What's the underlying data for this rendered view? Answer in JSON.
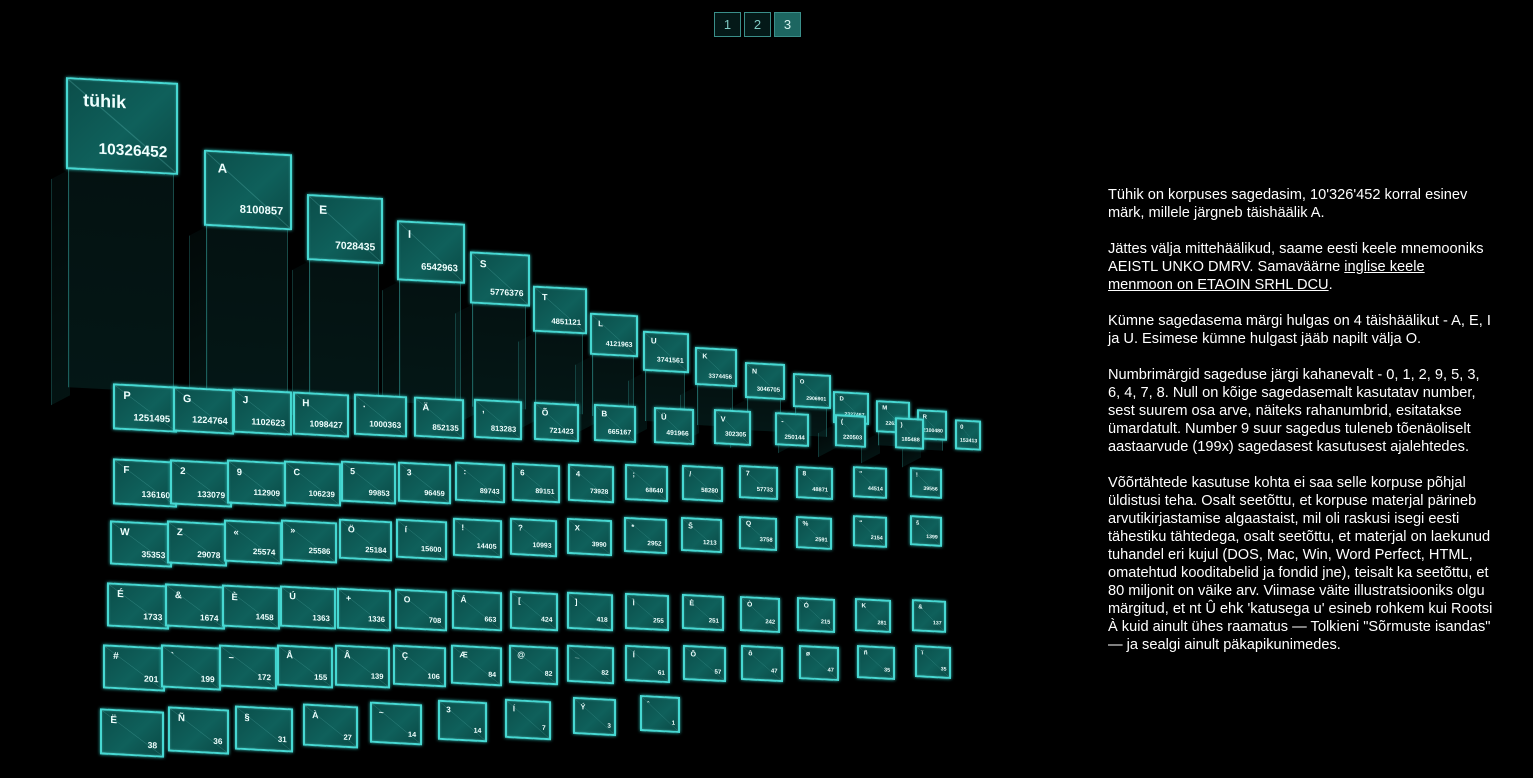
{
  "pager": {
    "pages": [
      "1",
      "2",
      "3"
    ],
    "active_index": 2
  },
  "accent_colors": {
    "card_edge": "#47d8d2",
    "card_fill": "#0f605b",
    "background": "#000000"
  },
  "chart_data": {
    "type": "bar",
    "categories": [
      "tühik",
      "A",
      "E",
      "I",
      "S",
      "T",
      "L",
      "U",
      "K",
      "N",
      "O",
      "D",
      "M",
      "R",
      "P",
      "G",
      "J",
      "H",
      ".",
      "Ä",
      "'",
      "Õ",
      "B",
      "Ü",
      "V",
      "-",
      "(",
      ")",
      "0",
      ",",
      "F",
      "2",
      "9",
      "C",
      "5",
      "1",
      "3",
      "6",
      "4",
      ":",
      "/",
      "7",
      "8",
      "\"",
      "ž",
      "W",
      "Z",
      "«",
      "»",
      "Ö",
      "í",
      "!",
      "?",
      "X",
      "*",
      "Š",
      "Q",
      "%",
      "“",
      "š",
      "É",
      "&",
      "È",
      "Ú",
      "+",
      "O",
      "Á",
      "[",
      "]",
      "Ì",
      "È",
      "Ò",
      "Ó",
      "K",
      "&",
      "#",
      "`",
      "–",
      "Å",
      "Â",
      "Ç",
      "Æ",
      "@",
      "_",
      "Í",
      "Ô",
      "ô",
      "ø",
      "ñ",
      "ï",
      "È",
      "Ñ",
      "§",
      "À",
      "~",
      "3",
      "Í",
      "Ý",
      "ˆ"
    ],
    "values": [
      10326452,
      8100857,
      7028435,
      6542963,
      5776376,
      4851121,
      4121963,
      3741561,
      3374456,
      3046705,
      2906901,
      2327467,
      2262552,
      2100480,
      1251495,
      1224764,
      1102623,
      1098427,
      1000363,
      852135,
      813283,
      721423,
      665167,
      491966,
      302305,
      250144,
      220503,
      185488,
      153413,
      136160,
      133079,
      112909,
      106239,
      99853,
      96459,
      89743,
      89151,
      73928,
      68640,
      58280,
      57733,
      48871,
      44514,
      35353,
      29078,
      25574,
      25586,
      25184,
      15600,
      14405,
      10993,
      3990,
      2952,
      1213,
      3758,
      2591,
      2154,
      1399,
      1733,
      1674,
      1458,
      1363,
      1336,
      708,
      663,
      424,
      418,
      255,
      251,
      242,
      215,
      281,
      137,
      201,
      199,
      172,
      155,
      139,
      106,
      84,
      82,
      82,
      61,
      57,
      47,
      47,
      35,
      35,
      38,
      36,
      31,
      27,
      14,
      14,
      7,
      3,
      1
    ],
    "title": "",
    "xlabel": "",
    "ylabel": ""
  },
  "rows": [
    [
      {
        "char": "tühik",
        "count": "10326452"
      },
      {
        "char": "A",
        "count": "8100857"
      },
      {
        "char": "E",
        "count": "7028435"
      },
      {
        "char": "I",
        "count": "6542963"
      },
      {
        "char": "S",
        "count": "5776376"
      },
      {
        "char": "T",
        "count": "4851121"
      },
      {
        "char": "L",
        "count": "4121963"
      },
      {
        "char": "U",
        "count": "3741561"
      },
      {
        "char": "K",
        "count": "3374456"
      },
      {
        "char": "N",
        "count": "3046705"
      },
      {
        "char": "O",
        "count": "2906901"
      },
      {
        "char": "D",
        "count": "2327467"
      },
      {
        "char": "M",
        "count": "2262552"
      },
      {
        "char": "R",
        "count": "2100480"
      }
    ],
    [
      {
        "char": "P",
        "count": "1251495"
      },
      {
        "char": "G",
        "count": "1224764"
      },
      {
        "char": "J",
        "count": "1102623"
      },
      {
        "char": "H",
        "count": "1098427"
      },
      {
        "char": ".",
        "count": "1000363"
      },
      {
        "char": "Ä",
        "count": "852135"
      },
      {
        "char": ",",
        "count": "813283"
      },
      {
        "char": "Õ",
        "count": "721423"
      },
      {
        "char": "B",
        "count": "665167"
      },
      {
        "char": "Ü",
        "count": "491966"
      },
      {
        "char": "V",
        "count": "302305"
      },
      {
        "char": "-",
        "count": "250144"
      },
      {
        "char": "(",
        "count": "220503"
      },
      {
        "char": ")",
        "count": "185488"
      },
      {
        "char": "0",
        "count": "153413"
      }
    ],
    [
      {
        "char": "F",
        "count": "136160"
      },
      {
        "char": "2",
        "count": "133079"
      },
      {
        "char": "9",
        "count": "112909"
      },
      {
        "char": "C",
        "count": "106239"
      },
      {
        "char": "5",
        "count": "99853"
      },
      {
        "char": "3",
        "count": "96459"
      },
      {
        "char": ":",
        "count": "89743"
      },
      {
        "char": "6",
        "count": "89151"
      },
      {
        "char": "4",
        "count": "73928"
      },
      {
        "char": ";",
        "count": "68640"
      },
      {
        "char": "/",
        "count": "58280"
      },
      {
        "char": "7",
        "count": "57733"
      },
      {
        "char": "8",
        "count": "48871"
      },
      {
        "char": "\"",
        "count": "44514"
      },
      {
        "char": "!",
        "count": "39556"
      }
    ],
    [
      {
        "char": "W",
        "count": "35353"
      },
      {
        "char": "Z",
        "count": "29078"
      },
      {
        "char": "«",
        "count": "25574"
      },
      {
        "char": "»",
        "count": "25586"
      },
      {
        "char": "Ö",
        "count": "25184"
      },
      {
        "char": "í",
        "count": "15600"
      },
      {
        "char": "!",
        "count": "14405"
      },
      {
        "char": "?",
        "count": "10993"
      },
      {
        "char": "X",
        "count": "3990"
      },
      {
        "char": "*",
        "count": "2952"
      },
      {
        "char": "Š",
        "count": "1213"
      },
      {
        "char": "Q",
        "count": "3758"
      },
      {
        "char": "%",
        "count": "2591"
      },
      {
        "char": "“",
        "count": "2154"
      },
      {
        "char": "š",
        "count": "1399"
      }
    ],
    [
      {
        "char": "É",
        "count": "1733"
      },
      {
        "char": "&",
        "count": "1674"
      },
      {
        "char": "È",
        "count": "1458"
      },
      {
        "char": "Ú",
        "count": "1363"
      },
      {
        "char": "+",
        "count": "1336"
      },
      {
        "char": "O",
        "count": "708"
      },
      {
        "char": "Á",
        "count": "663"
      },
      {
        "char": "[",
        "count": "424"
      },
      {
        "char": "]",
        "count": "418"
      },
      {
        "char": "Ì",
        "count": "255"
      },
      {
        "char": "È",
        "count": "251"
      },
      {
        "char": "Ò",
        "count": "242"
      },
      {
        "char": "Ó",
        "count": "215"
      },
      {
        "char": "K",
        "count": "281"
      },
      {
        "char": "&",
        "count": "137"
      }
    ],
    [
      {
        "char": "#",
        "count": "201"
      },
      {
        "char": "`",
        "count": "199"
      },
      {
        "char": "–",
        "count": "172"
      },
      {
        "char": "Å",
        "count": "155"
      },
      {
        "char": "Â",
        "count": "139"
      },
      {
        "char": "Ç",
        "count": "106"
      },
      {
        "char": "Æ",
        "count": "84"
      },
      {
        "char": "@",
        "count": "82"
      },
      {
        "char": "_",
        "count": "82"
      },
      {
        "char": "Í",
        "count": "61"
      },
      {
        "char": "Ô",
        "count": "57"
      },
      {
        "char": "ô",
        "count": "47"
      },
      {
        "char": "ø",
        "count": "47"
      },
      {
        "char": "ñ",
        "count": "35"
      },
      {
        "char": "ï",
        "count": "35"
      }
    ],
    [
      {
        "char": "Ë",
        "count": "38"
      },
      {
        "char": "Ñ",
        "count": "36"
      },
      {
        "char": "§",
        "count": "31"
      },
      {
        "char": "À",
        "count": "27"
      },
      {
        "char": "~",
        "count": "14"
      },
      {
        "char": "3",
        "count": "14"
      },
      {
        "char": "Í",
        "count": "7"
      },
      {
        "char": "Ý",
        "count": "3"
      },
      {
        "char": "ˆ",
        "count": "1"
      }
    ]
  ],
  "info": {
    "p1": "Tühik on korpuses sagedasim, 10'326'452 korral esinev märk, millele järgneb täishäälik A.",
    "p2_before": "Jättes välja mittehäälikud, saame eesti keele mnemooniks AEISTL UNKO DMRV. Samaväärne ",
    "p2_link": "inglise keele menmoon on ETAOIN SRHL DCU",
    "p2_after": ".",
    "p3": "Kümne sagedasema märgi hulgas on 4 täishäälikut - A, E, I ja U. Esimese kümne hulgast jääb napilt välja O.",
    "p4": "Numbrimärgid sageduse järgi kahanevalt - 0, 1, 2, 9, 5, 3, 6, 4, 7, 8. Null on kõige sagedasemalt kasutatav number, sest suurem osa arve, näiteks rahanumbrid, esitatakse ümardatult. Number 9 suur sagedus tuleneb tõenäoliselt aastaarvude (199x) sagedasest kasutusest ajalehtedes.",
    "p5": "Võõrtähtede kasutuse kohta ei saa selle korpuse põhjal üldistusi teha. Osalt seetõttu, et korpuse materjal pärineb arvutikirjastamise algaastaist, mil oli raskusi isegi eesti tähestiku tähtedega, osalt seetõttu, et materjal on laekunud tuhandel eri kujul (DOS, Mac, Win, Word Perfect, HTML, omatehtud kooditabelid ja fondid jne), teisalt ka seetõttu, et 80 miljonit on väike arv. Viimase väite illustratsiooniks olgu märgitud, et nt Û ehk 'katusega u' esineb rohkem kui Rootsi À kuid ainult ühes raamatus — Tolkieni \"Sõrmuste isandas\" — ja sealgi ainult päkapikunimedes."
  }
}
